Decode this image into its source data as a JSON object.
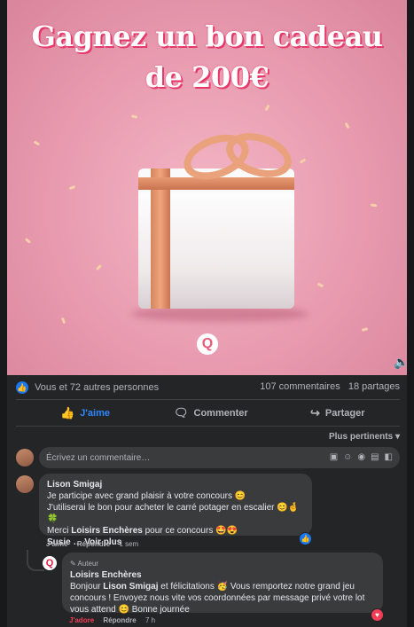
{
  "post": {
    "headline_line1": "Gagnez un bon cadeau",
    "headline_line2": "de 200€",
    "logo_glyph": "Q",
    "reactions_text": "Vous et 72 autres personnes",
    "comments_count": "107 commentaires",
    "shares_count": "18 partages"
  },
  "actions": {
    "like": "J'aime",
    "comment": "Commenter",
    "share": "Partager"
  },
  "sort": {
    "label": "Plus pertinents"
  },
  "composer": {
    "placeholder": "Écrivez un commentaire…"
  },
  "comments": [
    {
      "author": "Lison Smigaj",
      "line1": "Je participe avec grand plaisir à votre concours 😊",
      "line2": "J'utiliserai le bon pour acheter le carré potager en escalier 😊🤞🍀",
      "line3_prefix": "Merci",
      "line3_mention": "Loisirs Enchères",
      "line3_suffix": "pour ce concours 🤩😍",
      "line4_name": "Susie",
      "line4_more": "… Voir plus",
      "like_label": "J'aime",
      "reply_label": "Répondre",
      "time": "1 sem"
    }
  ],
  "reply": {
    "author_badge": "Auteur",
    "author": "Loisirs Enchères",
    "text_prefix": "Bonjour",
    "mention": "Lison Smigaj",
    "text_suffix": "et félicitations 🥳 Vous remportez notre grand jeu concours ! Envoyez nous vite vos coordonnées par message privé votre lot vous attend 😊 Bonne journée",
    "reaction_label": "J'adore",
    "reply_label": "Répondre",
    "time": "7 h"
  },
  "colors": {
    "accent": "#2d88ff",
    "love": "#f33e58",
    "background": "#242526"
  }
}
